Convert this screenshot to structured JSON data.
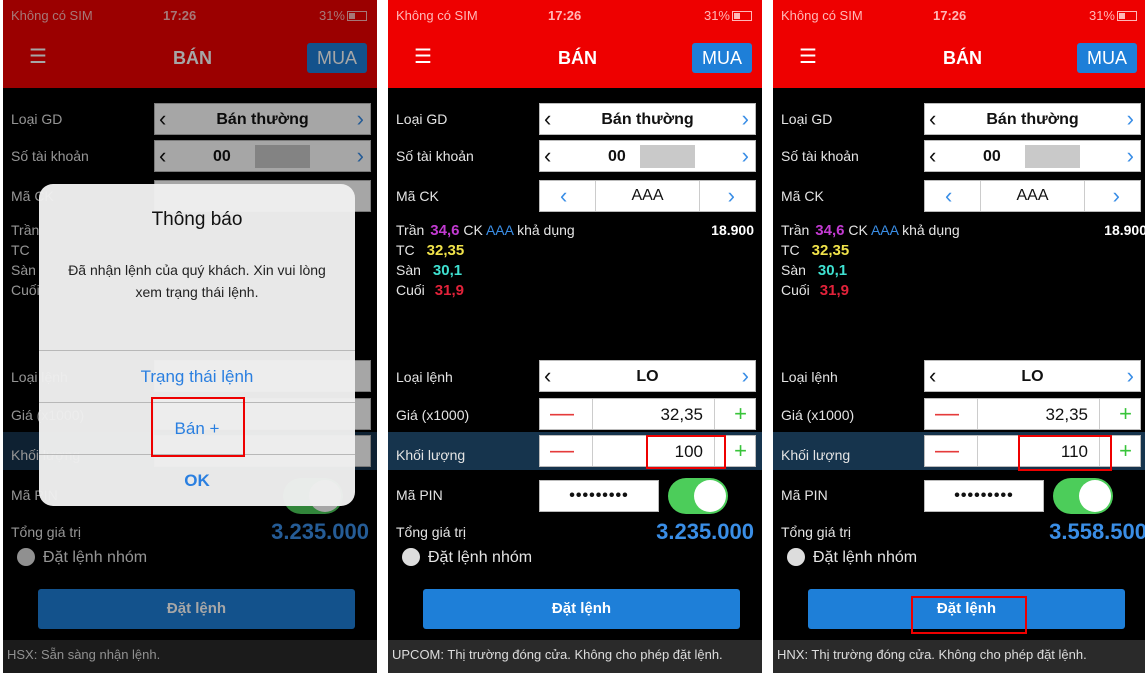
{
  "status": {
    "carrier": "Không có SIM",
    "wifi": "✹",
    "time": "17:26",
    "battery": "31%",
    "location": "◎"
  },
  "nav": {
    "title": "BÁN",
    "buy_label": "MUA",
    "menu_icon": "☰"
  },
  "labels": {
    "order_type": "Loại GD",
    "account": "Số tài khoản",
    "symbol": "Mã CK",
    "ceiling": "Trần",
    "reference": "TC",
    "floor": "Sàn",
    "last": "Cuối",
    "available_text": "CK",
    "available_suffix": "khả dụng",
    "order_kind": "Loại lệnh",
    "price": "Giá (x1000)",
    "quantity": "Khối lượng",
    "pin": "Mã PIN",
    "total": "Tổng giá trị",
    "group_order": "Đặt lệnh nhóm",
    "submit": "Đặt lệnh"
  },
  "order_type_value": "Bán thường",
  "account_prefix": "00",
  "symbol": "AAA",
  "prices": {
    "ceiling": "34,6",
    "reference": "32,35",
    "floor": "30,1",
    "last": "31,9"
  },
  "available_qty": "18.900",
  "order_kind": "LO",
  "price": "32,35",
  "pin_mask": "•••••••••",
  "screens": [
    {
      "quantity": "100",
      "total": "3.235.000",
      "footer": "HSX: Sẵn sàng nhận lệnh."
    },
    {
      "quantity": "100",
      "total": "3.235.000",
      "footer": "UPCOM: Thị trường đóng cửa. Không cho phép đặt lệnh."
    },
    {
      "quantity": "110",
      "total": "3.558.500",
      "footer": "HNX: Thị trường đóng cửa. Không cho phép đặt lệnh."
    }
  ],
  "dialog": {
    "title": "Thông báo",
    "message": "Đã nhận lệnh của quý khách. Xin vui lòng xem trạng thái lệnh.",
    "btn_status": "Trạng thái lệnh",
    "btn_sell_more": "Bán +",
    "btn_ok": "OK",
    "partial_right": "00"
  },
  "colors": {
    "ceiling": "#c23ad1",
    "reference": "#f0e24a",
    "floor": "#3fe0d0",
    "last": "#e2223a",
    "accent": "#1e7fd8",
    "header": "#e00000"
  }
}
